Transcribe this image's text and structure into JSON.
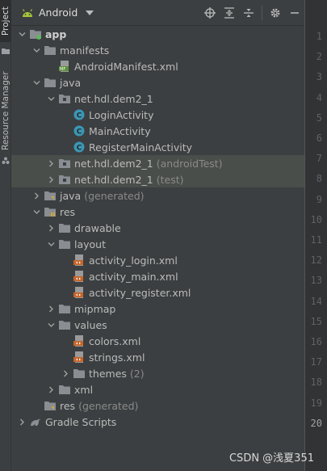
{
  "side_strip": {
    "project_tab": "Project",
    "resource_manager_tab": "Resource Manager"
  },
  "toolbar": {
    "view_name": "Android"
  },
  "tree": [
    {
      "label": "app",
      "bold": true,
      "icon": "module-folder-icon",
      "arrow": "down",
      "level": 0
    },
    {
      "label": "manifests",
      "icon": "folder-icon",
      "arrow": "down",
      "level": 1
    },
    {
      "label": "AndroidManifest.xml",
      "icon": "manifest-file-icon",
      "arrow": "",
      "level": 2
    },
    {
      "label": "java",
      "icon": "folder-icon",
      "arrow": "down",
      "level": 1
    },
    {
      "label": "net.hdl.dem2_1",
      "icon": "package-icon",
      "arrow": "down",
      "level": 2
    },
    {
      "label": "LoginActivity",
      "icon": "class-icon",
      "arrow": "",
      "level": 3
    },
    {
      "label": "MainActivity",
      "icon": "class-icon",
      "arrow": "",
      "level": 3
    },
    {
      "label": "RegisterMainActivity",
      "icon": "class-icon",
      "arrow": "",
      "level": 3
    },
    {
      "label": "net.hdl.dem2_1",
      "suffix": "(androidTest)",
      "icon": "package-icon",
      "arrow": "right",
      "level": 2,
      "highlight": true
    },
    {
      "label": "net.hdl.dem2_1",
      "suffix": "(test)",
      "icon": "package-icon",
      "arrow": "right",
      "level": 2,
      "highlight": true
    },
    {
      "label": "java",
      "suffix": "(generated)",
      "icon": "generated-folder-icon",
      "arrow": "right",
      "level": 1
    },
    {
      "label": "res",
      "icon": "res-folder-icon",
      "arrow": "down",
      "level": 1
    },
    {
      "label": "drawable",
      "icon": "folder-icon",
      "arrow": "right",
      "level": 2
    },
    {
      "label": "layout",
      "icon": "folder-icon",
      "arrow": "down",
      "level": 2
    },
    {
      "label": "activity_login.xml",
      "icon": "layout-file-icon",
      "arrow": "",
      "level": 3
    },
    {
      "label": "activity_main.xml",
      "icon": "layout-file-icon",
      "arrow": "",
      "level": 3
    },
    {
      "label": "activity_register.xml",
      "icon": "layout-file-icon",
      "arrow": "",
      "level": 3
    },
    {
      "label": "mipmap",
      "icon": "folder-icon",
      "arrow": "right",
      "level": 2
    },
    {
      "label": "values",
      "icon": "folder-icon",
      "arrow": "down",
      "level": 2
    },
    {
      "label": "colors.xml",
      "icon": "values-file-icon",
      "arrow": "",
      "level": 3
    },
    {
      "label": "strings.xml",
      "icon": "values-file-icon",
      "arrow": "",
      "level": 3
    },
    {
      "label": "themes",
      "suffix": "(2)",
      "icon": "folder-icon",
      "arrow": "right",
      "level": 3
    },
    {
      "label": "xml",
      "icon": "folder-icon",
      "arrow": "right",
      "level": 2
    },
    {
      "label": "res",
      "suffix": "(generated)",
      "icon": "generated-folder-icon",
      "arrow": "",
      "level": 1
    },
    {
      "label": "Gradle Scripts",
      "icon": "gradle-icon",
      "arrow": "right",
      "level": 0
    }
  ],
  "gutter_lines": [
    "1",
    "2",
    "3",
    "4",
    "5",
    "6",
    "7",
    "8",
    "9",
    "10",
    "11",
    "12",
    "13",
    "14",
    "15",
    "16",
    "17",
    "18",
    "19",
    "20"
  ],
  "current_line": "20",
  "watermark": "CSDN @浅夏351",
  "colors": {
    "android_green": "#a4c639",
    "folder": "#8a8d91",
    "class_icon": "#3a97b6",
    "xml_icon": "#c7652a",
    "highlight_row": "#4a4e4b"
  }
}
